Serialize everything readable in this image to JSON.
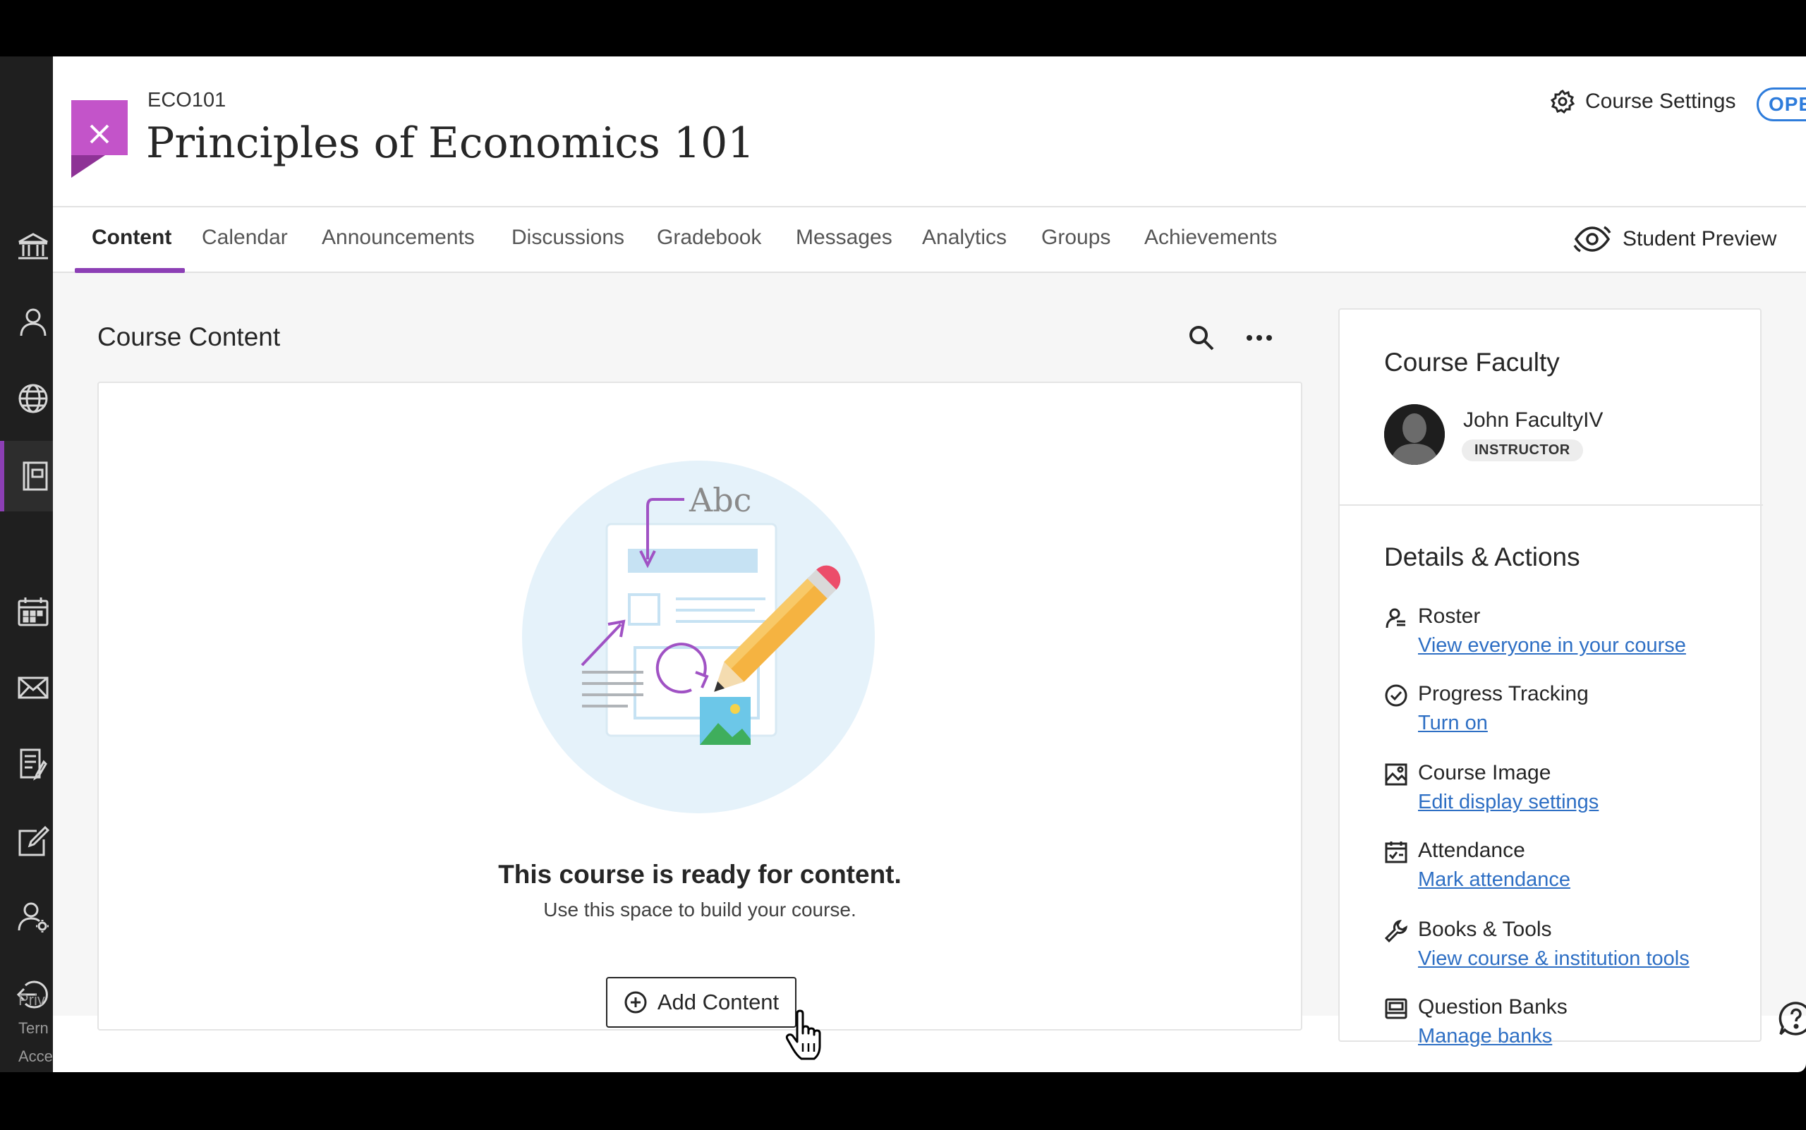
{
  "header": {
    "course_code": "ECO101",
    "course_title": "Principles of Economics 101",
    "settings_label": "Course Settings",
    "status_badge": "OPEN"
  },
  "tabs": [
    {
      "label": "Content",
      "active": true
    },
    {
      "label": "Calendar"
    },
    {
      "label": "Announcements"
    },
    {
      "label": "Discussions"
    },
    {
      "label": "Gradebook"
    },
    {
      "label": "Messages"
    },
    {
      "label": "Analytics"
    },
    {
      "label": "Groups"
    },
    {
      "label": "Achievements"
    }
  ],
  "student_preview_label": "Student Preview",
  "sidebar": {
    "icons": [
      "institution-icon",
      "profile-icon",
      "globe-icon",
      "courses-icon",
      "calendar-icon",
      "messages-icon",
      "grades-icon",
      "tools-icon",
      "user-icon",
      "sign-out-icon"
    ],
    "footer_links": [
      "Priv",
      "Tern",
      "Acce"
    ]
  },
  "course_content": {
    "title": "Course Content",
    "illustration_text": "Abc",
    "empty_title": "This course is ready for content.",
    "empty_subtitle": "Use this space to build your course.",
    "add_button_label": "Add Content"
  },
  "faculty": {
    "title": "Course Faculty",
    "name": "John FacultyIV",
    "role": "INSTRUCTOR"
  },
  "details": {
    "title": "Details & Actions",
    "items": [
      {
        "icon": "roster-icon",
        "label": "Roster",
        "link": "View everyone in your course"
      },
      {
        "icon": "progress-check-icon",
        "label": "Progress Tracking",
        "link": "Turn on"
      },
      {
        "icon": "image-icon",
        "label": "Course Image",
        "link": "Edit display settings"
      },
      {
        "icon": "attendance-icon",
        "label": "Attendance",
        "link": "Mark attendance"
      },
      {
        "icon": "wrench-icon",
        "label": "Books & Tools",
        "link": "View course & institution tools"
      },
      {
        "icon": "question-bank-icon",
        "label": "Question Banks",
        "link": "Manage banks"
      }
    ]
  },
  "colors": {
    "accent_purple": "#8c3fb5",
    "close_button": "#c354c9",
    "link_blue": "#2e6fc4",
    "badge_blue": "#2e7cdb"
  }
}
